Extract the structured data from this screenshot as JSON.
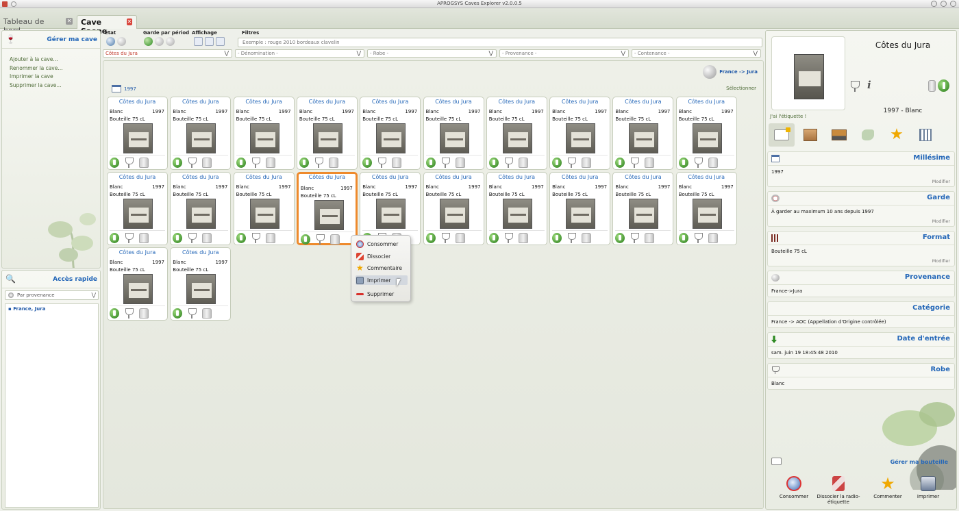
{
  "window": {
    "title": "APROGSYS Caves Explorer v2.0.0.5"
  },
  "tabs": [
    {
      "label": "Tableau de bord",
      "active": false
    },
    {
      "label": "Cave Saone",
      "active": true
    }
  ],
  "left_panel": {
    "manage_title": "Gérer ma cave",
    "actions": [
      "Ajouter à la cave...",
      "Renommer la cave...",
      "Imprimer la cave",
      "Supprimer la cave..."
    ],
    "quick_title": "Accès rapide",
    "quick_filter": "Par provenance",
    "tree": [
      "France, Jura"
    ]
  },
  "toolbar": {
    "etat_label": "État",
    "garde_label": "Garde par périod",
    "affichage_label": "Affichage",
    "filtres_label": "Filtres",
    "filter_placeholder": "Exemple : rouge 2010 bordeaux clavelin",
    "dropdowns": [
      "Côtes du Jura",
      "- Dénomination -",
      "- Robe -",
      "- Provenance -",
      "- Contenance -"
    ]
  },
  "main": {
    "location": "France -> Jura",
    "year_group": "1997",
    "select_label": "Sélectionner",
    "cards": [
      {
        "name": "Côtes du Jura",
        "color": "Blanc",
        "year": "1997",
        "format": "Bouteille 75 cL"
      }
    ],
    "card_count": 22,
    "highlighted_card_index": 13
  },
  "context_menu": {
    "items": [
      "Consommer",
      "Dissocier",
      "Commentaire",
      "Imprimer",
      "Supprimer"
    ],
    "active_index": 3
  },
  "right_panel": {
    "wine_name": "Côtes du Jura",
    "subtitle": "1997 - Blanc",
    "label_text": "J'ai l'étiquette !",
    "info_glyph": "i",
    "sections": [
      {
        "title": "Millésime",
        "value": "1997",
        "modify": "Modifier"
      },
      {
        "title": "Garde",
        "value": "À garder au maximum 10 ans depuis 1997",
        "modify": "Modifier"
      },
      {
        "title": "Format",
        "value": "Bouteille 75 cL",
        "modify": "Modifier"
      },
      {
        "title": "Provenance",
        "value": "France->Jura"
      },
      {
        "title": "Catégorie",
        "value": "France -> AOC (Appellation d'Origine contrôlée)"
      },
      {
        "title": "Date d'entrée",
        "value": "sam. juin 19 18:45:48 2010"
      },
      {
        "title": "Robe",
        "value": "Blanc"
      }
    ],
    "manage_bottle": "Gérer ma bouteille",
    "actions": [
      "Consommer",
      "Dissocier la radio-étiquette",
      "Commenter",
      "Imprimer"
    ]
  },
  "colors": {
    "accent_blue": "#2467b8",
    "highlight_orange": "#ee8a2c",
    "green": "#2e8a22"
  }
}
